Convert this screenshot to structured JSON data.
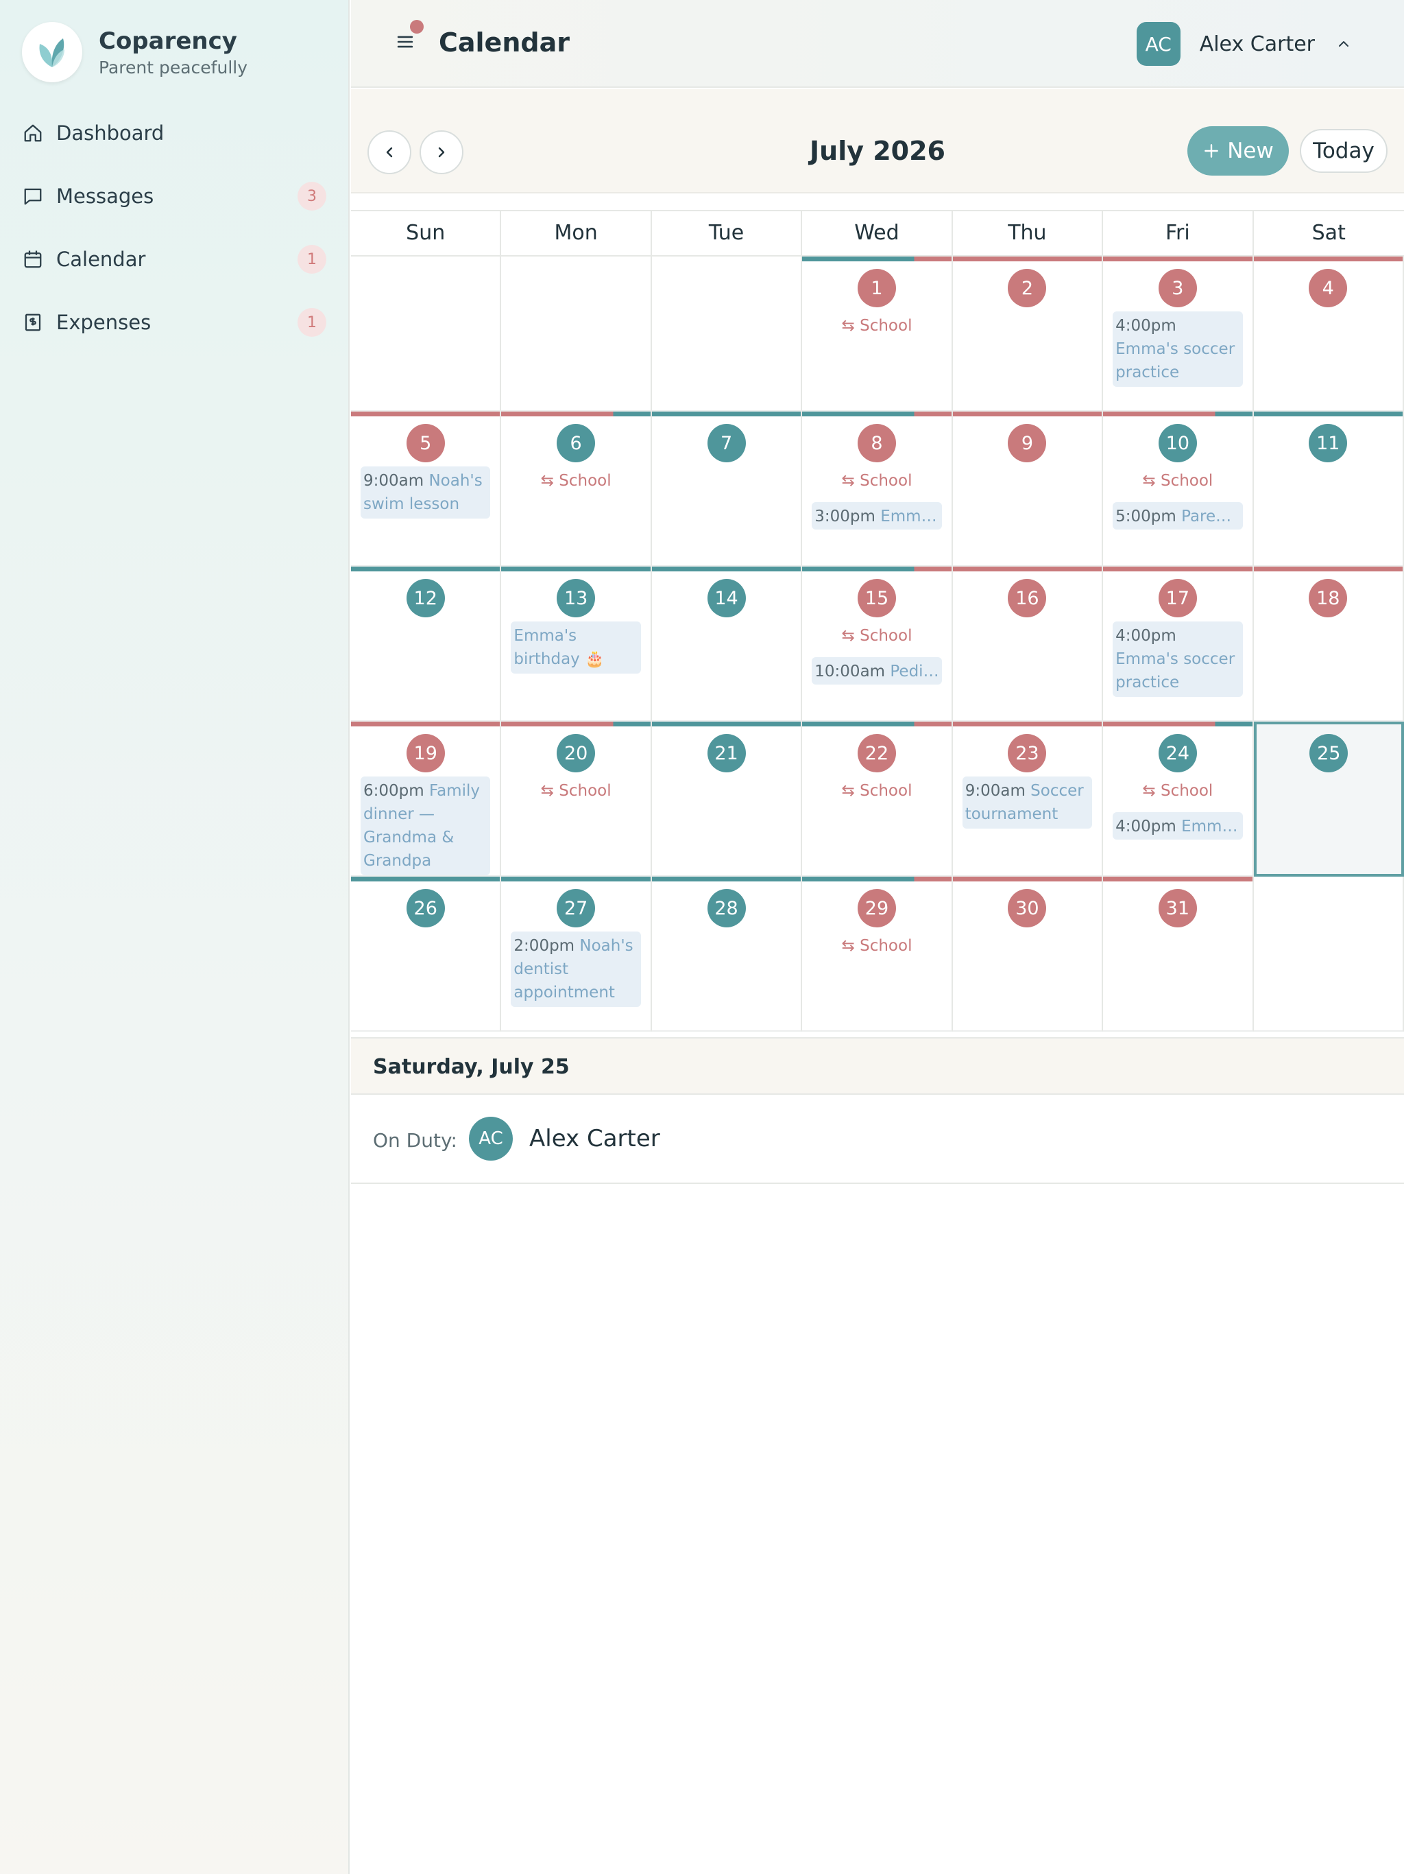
{
  "app": {
    "name": "Coparency",
    "tagline": "Parent peacefully"
  },
  "sidebar": {
    "items": [
      {
        "label": "Dashboard",
        "icon": "home-icon",
        "badge": ""
      },
      {
        "label": "Messages",
        "icon": "message-icon",
        "badge": "3"
      },
      {
        "label": "Calendar",
        "icon": "calendar-icon",
        "badge": "1"
      },
      {
        "label": "Expenses",
        "icon": "receipt-icon",
        "badge": "1"
      }
    ]
  },
  "header": {
    "title": "Calendar",
    "user_initials": "AC",
    "user_name": "Alex Carter"
  },
  "toolbar": {
    "month": "July 2026",
    "new_label": "New",
    "today_label": "Today"
  },
  "colors": {
    "parent_a": "#4f969b",
    "parent_b": "#c97a7c",
    "accent": "#6eaeb1",
    "event_bg": "#e7eff6"
  },
  "weekdays": [
    "Sun",
    "Mon",
    "Tue",
    "Wed",
    "Thu",
    "Fri",
    "Sat"
  ],
  "calendar": {
    "today": 25,
    "days": [
      {
        "day": 1,
        "col": 3,
        "row": 0,
        "parent": "b",
        "bar": [
          "a",
          "b"
        ],
        "school": "School",
        "events": []
      },
      {
        "day": 2,
        "col": 4,
        "row": 0,
        "parent": "b",
        "bar": [
          "b"
        ],
        "school": "",
        "events": []
      },
      {
        "day": 3,
        "col": 5,
        "row": 0,
        "parent": "b",
        "bar": [
          "b"
        ],
        "school": "",
        "events": [
          {
            "time": "4:00pm",
            "title": "Emma's soccer practice",
            "wrap": true
          }
        ]
      },
      {
        "day": 4,
        "col": 6,
        "row": 0,
        "parent": "b",
        "bar": [
          "b"
        ],
        "school": "",
        "events": []
      },
      {
        "day": 5,
        "col": 0,
        "row": 1,
        "parent": "b",
        "bar": [
          "b"
        ],
        "school": "",
        "events": [
          {
            "time": "9:00am",
            "title": "Noah's swim lesson",
            "wrap": true
          }
        ]
      },
      {
        "day": 6,
        "col": 1,
        "row": 1,
        "parent": "a",
        "bar": [
          "b",
          "a"
        ],
        "school": "School",
        "events": []
      },
      {
        "day": 7,
        "col": 2,
        "row": 1,
        "parent": "a",
        "bar": [
          "a"
        ],
        "school": "",
        "events": []
      },
      {
        "day": 8,
        "col": 3,
        "row": 1,
        "parent": "b",
        "bar": [
          "a",
          "b"
        ],
        "school": "School",
        "events": [
          {
            "time": "3:00pm",
            "title": "Emma's piano recital",
            "wrap": false
          }
        ]
      },
      {
        "day": 9,
        "col": 4,
        "row": 1,
        "parent": "b",
        "bar": [
          "b"
        ],
        "school": "",
        "events": []
      },
      {
        "day": 10,
        "col": 5,
        "row": 1,
        "parent": "a",
        "bar": [
          "b",
          "a"
        ],
        "school": "School",
        "events": [
          {
            "time": "5:00pm",
            "title": "Parent-teacher meeting",
            "wrap": false
          }
        ]
      },
      {
        "day": 11,
        "col": 6,
        "row": 1,
        "parent": "a",
        "bar": [
          "a"
        ],
        "school": "",
        "events": []
      },
      {
        "day": 12,
        "col": 0,
        "row": 2,
        "parent": "a",
        "bar": [
          "a"
        ],
        "school": "",
        "events": []
      },
      {
        "day": 13,
        "col": 1,
        "row": 2,
        "parent": "a",
        "bar": [
          "a"
        ],
        "school": "",
        "events": [
          {
            "time": "",
            "title": "Emma's birthday 🎂",
            "wrap": true
          }
        ]
      },
      {
        "day": 14,
        "col": 2,
        "row": 2,
        "parent": "a",
        "bar": [
          "a"
        ],
        "school": "",
        "events": []
      },
      {
        "day": 15,
        "col": 3,
        "row": 2,
        "parent": "b",
        "bar": [
          "a",
          "b"
        ],
        "school": "School",
        "events": [
          {
            "time": "10:00am",
            "title": "Pediatrician checkup",
            "wrap": false
          }
        ]
      },
      {
        "day": 16,
        "col": 4,
        "row": 2,
        "parent": "b",
        "bar": [
          "b"
        ],
        "school": "",
        "events": []
      },
      {
        "day": 17,
        "col": 5,
        "row": 2,
        "parent": "b",
        "bar": [
          "b"
        ],
        "school": "",
        "events": [
          {
            "time": "4:00pm",
            "title": "Emma's soccer practice",
            "wrap": true
          }
        ]
      },
      {
        "day": 18,
        "col": 6,
        "row": 2,
        "parent": "b",
        "bar": [
          "b"
        ],
        "school": "",
        "events": []
      },
      {
        "day": 19,
        "col": 0,
        "row": 3,
        "parent": "b",
        "bar": [
          "b"
        ],
        "school": "",
        "events": [
          {
            "time": "6:00pm",
            "title": "Family dinner — Grandma & Grandpa",
            "wrap": true
          }
        ]
      },
      {
        "day": 20,
        "col": 1,
        "row": 3,
        "parent": "a",
        "bar": [
          "b",
          "a"
        ],
        "school": "School",
        "events": []
      },
      {
        "day": 21,
        "col": 2,
        "row": 3,
        "parent": "a",
        "bar": [
          "a"
        ],
        "school": "",
        "events": []
      },
      {
        "day": 22,
        "col": 3,
        "row": 3,
        "parent": "b",
        "bar": [
          "a",
          "b"
        ],
        "school": "School",
        "events": []
      },
      {
        "day": 23,
        "col": 4,
        "row": 3,
        "parent": "b",
        "bar": [
          "b"
        ],
        "school": "",
        "events": [
          {
            "time": "9:00am",
            "title": "Soccer tournament",
            "wrap": true
          }
        ]
      },
      {
        "day": 24,
        "col": 5,
        "row": 3,
        "parent": "a",
        "bar": [
          "b",
          "a"
        ],
        "school": "School",
        "events": [
          {
            "time": "4:00pm",
            "title": "Emma's soccer practice",
            "wrap": false
          }
        ]
      },
      {
        "day": 25,
        "col": 6,
        "row": 3,
        "parent": "a",
        "bar": [
          "a"
        ],
        "school": "",
        "events": []
      },
      {
        "day": 26,
        "col": 0,
        "row": 4,
        "parent": "a",
        "bar": [
          "a"
        ],
        "school": "",
        "events": []
      },
      {
        "day": 27,
        "col": 1,
        "row": 4,
        "parent": "a",
        "bar": [
          "a"
        ],
        "school": "",
        "events": [
          {
            "time": "2:00pm",
            "title": "Noah's dentist appointment",
            "wrap": true
          }
        ]
      },
      {
        "day": 28,
        "col": 2,
        "row": 4,
        "parent": "a",
        "bar": [
          "a"
        ],
        "school": "",
        "events": []
      },
      {
        "day": 29,
        "col": 3,
        "row": 4,
        "parent": "b",
        "bar": [
          "a",
          "b"
        ],
        "school": "School",
        "events": []
      },
      {
        "day": 30,
        "col": 4,
        "row": 4,
        "parent": "b",
        "bar": [
          "b"
        ],
        "school": "",
        "events": []
      },
      {
        "day": 31,
        "col": 5,
        "row": 4,
        "parent": "b",
        "bar": [
          "b"
        ],
        "school": "",
        "events": []
      }
    ]
  },
  "detail": {
    "title": "Saturday, July 25",
    "on_duty_label": "On Duty:",
    "on_duty_initials": "AC",
    "on_duty_name": "Alex Carter"
  }
}
